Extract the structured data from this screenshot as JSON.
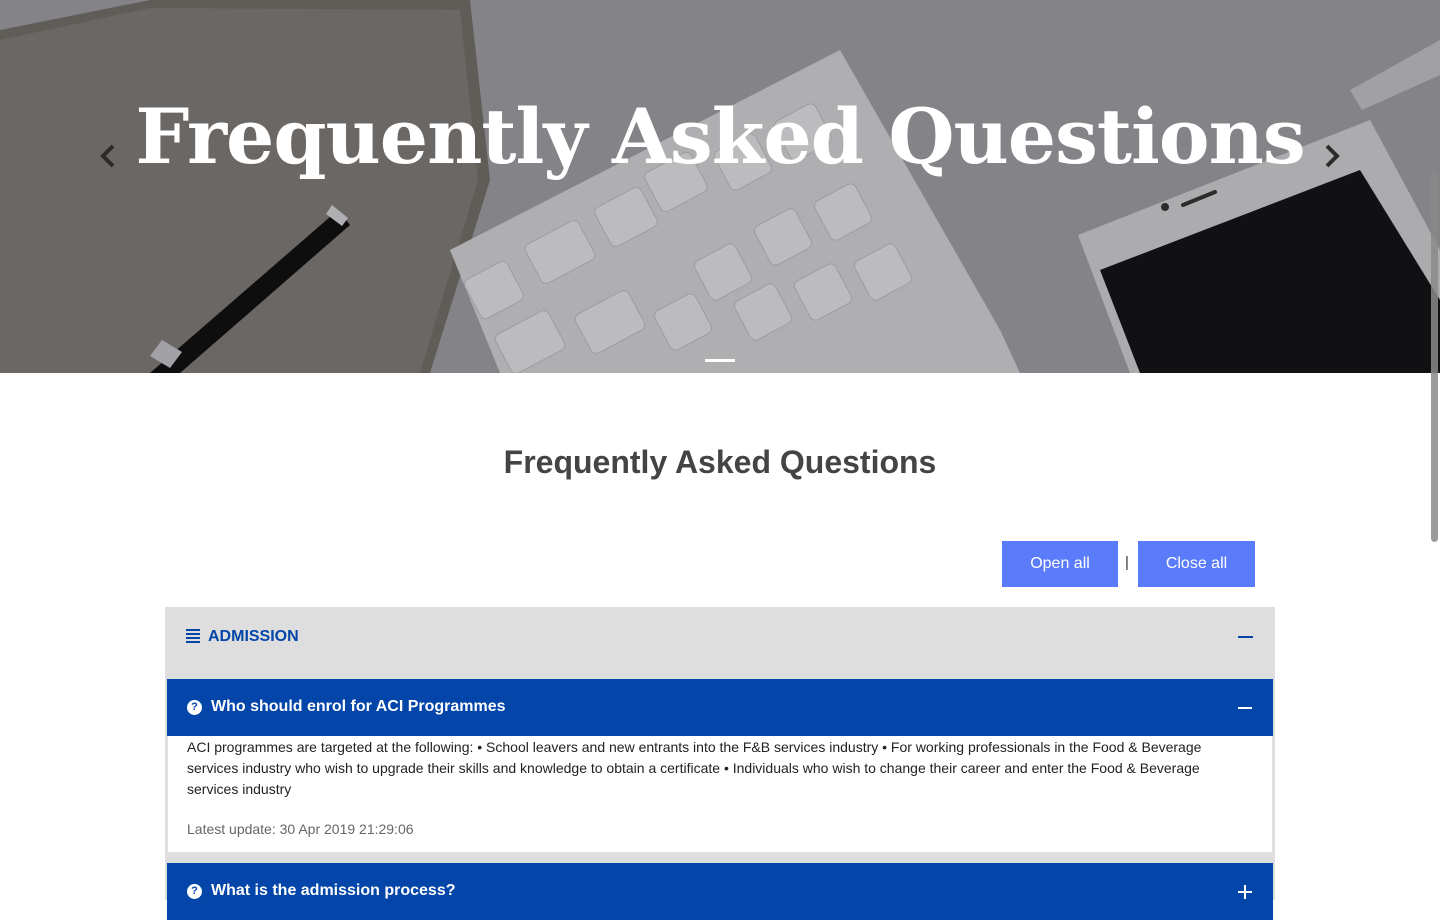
{
  "hero": {
    "title": "Frequently Asked Questions",
    "prev_icon": "chevron-left-icon",
    "next_icon": "chevron-right-icon"
  },
  "page": {
    "heading": "Frequently Asked Questions"
  },
  "controls": {
    "open_all": "Open all",
    "separator": "|",
    "close_all": "Close all"
  },
  "categories": [
    {
      "icon": "list-icon",
      "title": "ADMISSION",
      "expanded": true,
      "faqs": [
        {
          "question": "Who should enrol for ACI Programmes",
          "expanded": true,
          "answer": "ACI programmes are targeted at the following: • School leavers and new entrants into the F&B services industry • For working professionals in the Food & Beverage services industry who wish to upgrade their skills and knowledge to obtain a certificate • Individuals who wish to change their career and enter the Food & Beverage services industry",
          "latest_update": "Latest update: 30 Apr 2019 21:29:06"
        },
        {
          "question": "What is the admission process?",
          "expanded": false
        }
      ]
    }
  ],
  "colors": {
    "brand_blue": "#0345a8",
    "button_blue": "#5b7cfa",
    "category_bg": "#dedede",
    "heading_gray": "#444444"
  }
}
